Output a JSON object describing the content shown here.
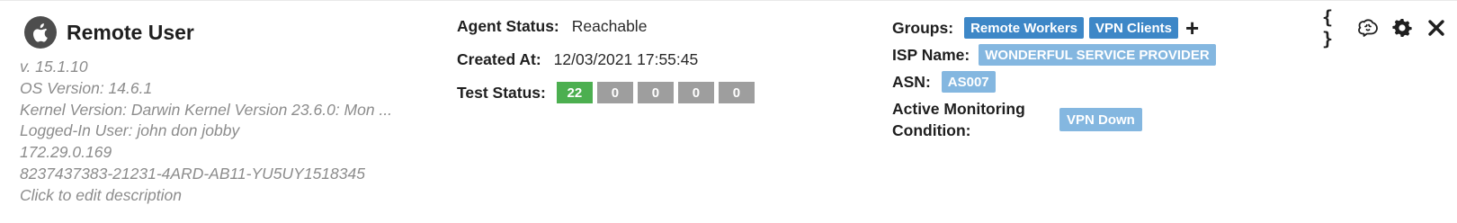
{
  "agent": {
    "name": "Remote User",
    "os_icon": "apple-icon",
    "details": [
      "v. 15.1.10",
      "OS Version: 14.6.1",
      "Kernel Version: Darwin Kernel Version 23.6.0: Mon ...",
      "Logged-In User: john don jobby",
      "172.29.0.169",
      "8237437383-21231-4ARD-AB11-YU5UY1518345"
    ],
    "edit_description": "Click to edit description"
  },
  "status": {
    "agent_status_label": "Agent Status:",
    "agent_status_value": "Reachable",
    "created_label": "Created At:",
    "created_value": "12/03/2021 17:55:45",
    "test_status_label": "Test Status:",
    "test_counts": [
      {
        "value": "22",
        "color": "#4caf50"
      },
      {
        "value": "0",
        "color": "#9e9e9e"
      },
      {
        "value": "0",
        "color": "#9e9e9e"
      },
      {
        "value": "0",
        "color": "#9e9e9e"
      },
      {
        "value": "0",
        "color": "#9e9e9e"
      }
    ]
  },
  "info": {
    "groups_label": "Groups:",
    "groups": [
      "Remote Workers",
      "VPN Clients"
    ],
    "add_group_glyph": "+",
    "isp_label": "ISP Name:",
    "isp_value": "WONDERFUL SERVICE PROVIDER",
    "asn_label": "ASN:",
    "asn_value": "AS007",
    "amc_label_line1": "Active Monitoring",
    "amc_label_line2": "Condition:",
    "amc_value": "VPN Down"
  },
  "toolbar": {
    "json_glyph": "{ }",
    "icons": [
      "json-icon",
      "brain-icon",
      "gear-icon",
      "close-icon"
    ]
  },
  "colors": {
    "group_tag": "#3d87c7",
    "info_tag": "#84b7e0",
    "pass": "#4caf50",
    "neutral": "#9e9e9e",
    "meta_text": "#8c8c8c"
  }
}
